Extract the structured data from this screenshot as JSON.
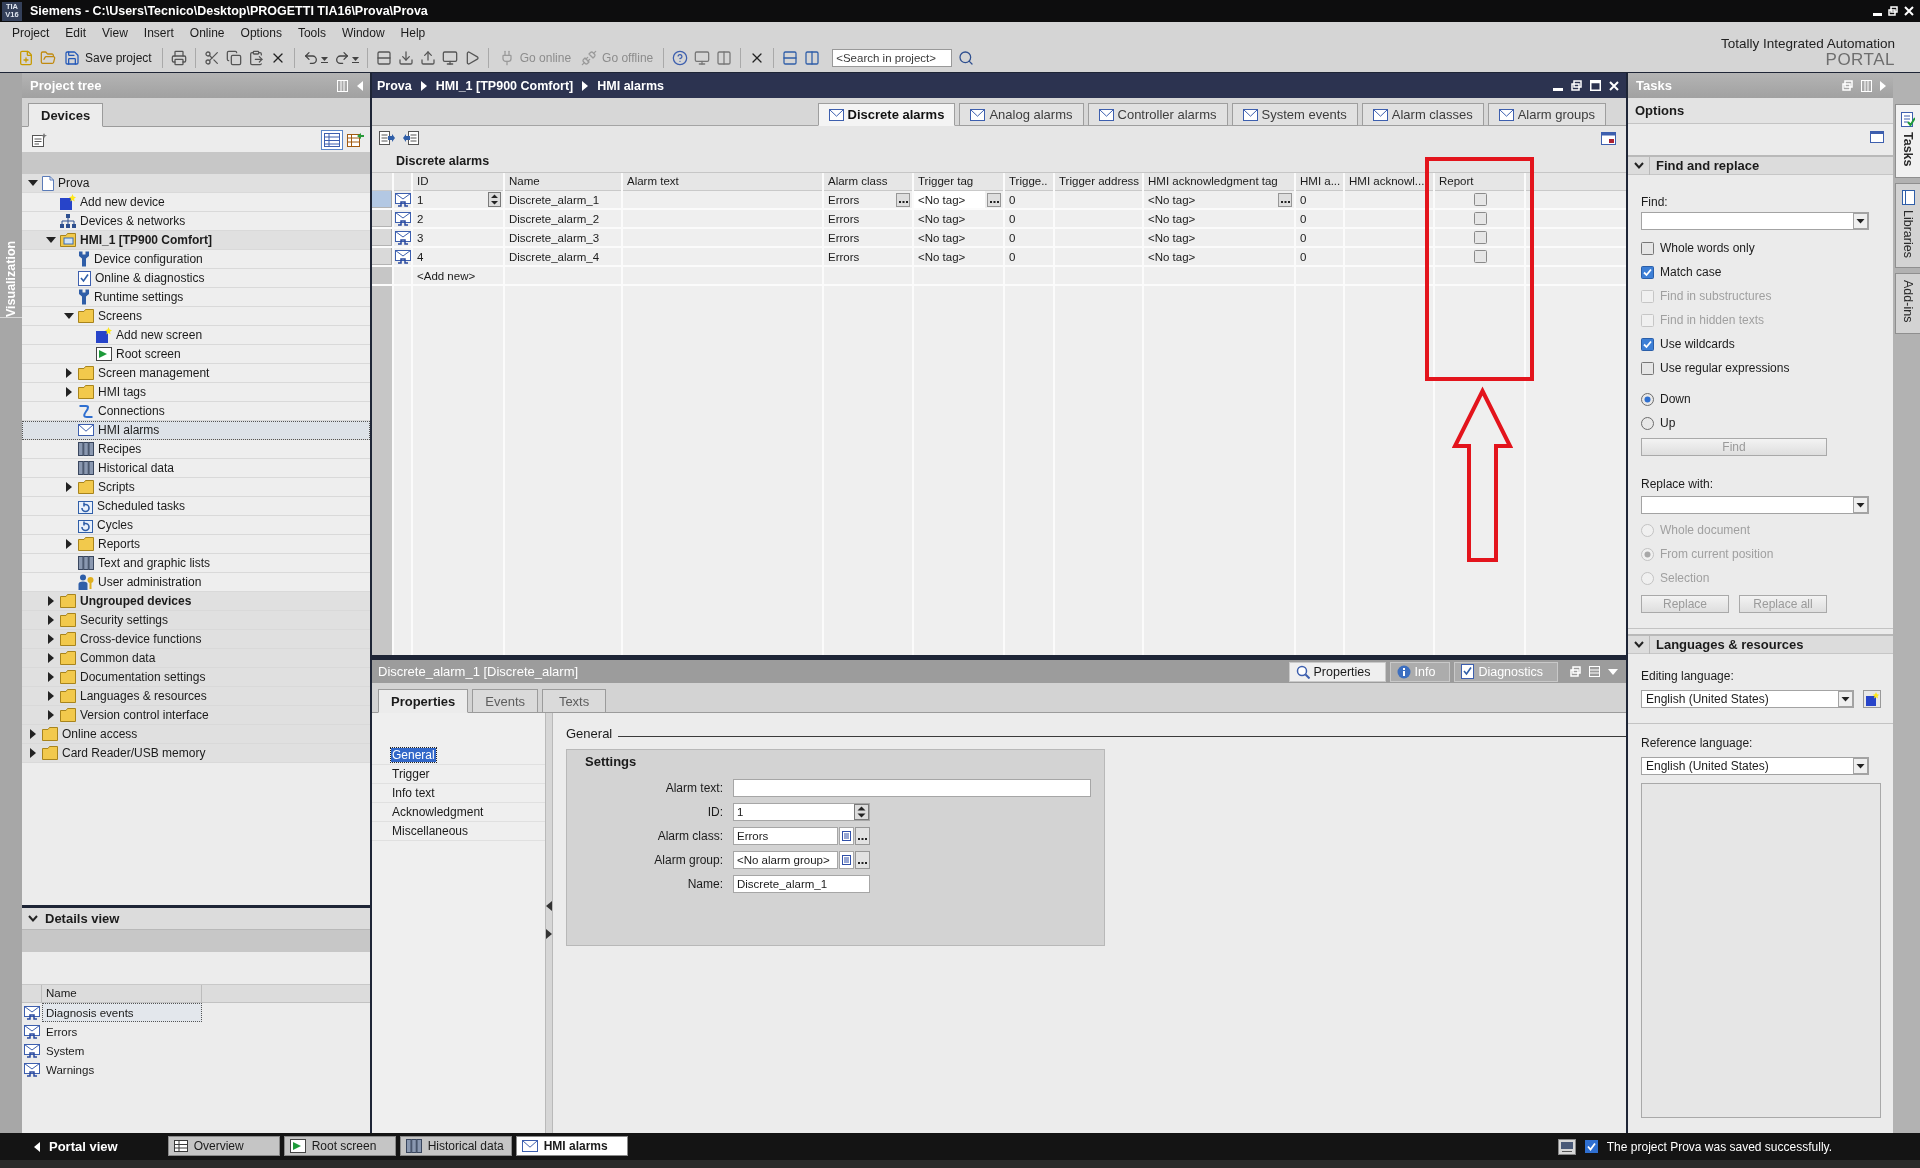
{
  "window": {
    "logo": [
      "TIA",
      "V16"
    ],
    "title": "Siemens - C:\\Users\\Tecnico\\Desktop\\PROGETTI TIA16\\Prova\\Prova"
  },
  "menu": [
    "Project",
    "Edit",
    "View",
    "Insert",
    "Online",
    "Options",
    "Tools",
    "Window",
    "Help"
  ],
  "toolbar": {
    "buttons": [
      {
        "label": "Save project",
        "disabled": false
      },
      {
        "label": "Go online",
        "disabled": true
      },
      {
        "label": "Go offline",
        "disabled": true
      }
    ],
    "search": {
      "placeholder": "<Search in project>"
    }
  },
  "branding": {
    "line_1": "Totally Integrated Automation",
    "line_2": "PORTAL"
  },
  "side_strip": {
    "label": "Visualization"
  },
  "project_tree": {
    "title": "Project tree",
    "tabs": [
      {
        "label": "Devices",
        "selected": true
      }
    ],
    "items": [
      {
        "label": "Prova",
        "kind": "project",
        "expanded": true,
        "selected": false,
        "children": [
          {
            "label": "Add new device",
            "kind": "add",
            "selected": false
          },
          {
            "label": "Devices & networks",
            "kind": "network",
            "selected": false
          },
          {
            "label": "HMI_1 [TP900 Comfort]",
            "kind": "device",
            "expanded": true,
            "selected": false,
            "children": [
              {
                "label": "Device configuration",
                "kind": "settings",
                "selected": false
              },
              {
                "label": "Online & diagnostics",
                "kind": "diagnostics",
                "selected": false
              },
              {
                "label": "Runtime settings",
                "kind": "settings",
                "selected": false
              },
              {
                "label": "Screens",
                "kind": "folder",
                "expanded": true,
                "selected": false,
                "children": [
                  {
                    "label": "Add new screen",
                    "kind": "add",
                    "selected": false
                  },
                  {
                    "label": "Root screen",
                    "kind": "screen",
                    "selected": false
                  }
                ]
              },
              {
                "label": "Screen management",
                "kind": "folder",
                "expanded": false,
                "selected": false
              },
              {
                "label": "HMI tags",
                "kind": "folder",
                "expanded": false,
                "selected": false
              },
              {
                "label": "Connections",
                "kind": "connections",
                "selected": false
              },
              {
                "label": "HMI alarms",
                "kind": "alarms",
                "selected": true
              },
              {
                "label": "Recipes",
                "kind": "records",
                "selected": false
              },
              {
                "label": "Historical data",
                "kind": "records",
                "selected": false
              },
              {
                "label": "Scripts",
                "kind": "folder",
                "expanded": false,
                "selected": false
              },
              {
                "label": "Scheduled tasks",
                "kind": "tasks",
                "selected": false
              },
              {
                "label": "Cycles",
                "kind": "tasks",
                "selected": false
              },
              {
                "label": "Reports",
                "kind": "folder",
                "expanded": false,
                "selected": false
              },
              {
                "label": "Text and graphic lists",
                "kind": "records",
                "selected": false
              },
              {
                "label": "User administration",
                "kind": "users",
                "selected": false
              }
            ]
          },
          {
            "label": "Ungrouped devices",
            "kind": "group",
            "expanded": false,
            "selected": false
          },
          {
            "label": "Security settings",
            "kind": "folder",
            "expanded": false,
            "selected": false
          },
          {
            "label": "Cross-device functions",
            "kind": "folder",
            "expanded": false,
            "selected": false
          },
          {
            "label": "Common data",
            "kind": "folder",
            "expanded": false,
            "selected": false
          },
          {
            "label": "Documentation settings",
            "kind": "folder",
            "expanded": false,
            "selected": false
          },
          {
            "label": "Languages & resources",
            "kind": "folder",
            "expanded": false,
            "selected": false
          },
          {
            "label": "Version control interface",
            "kind": "folder",
            "expanded": false,
            "selected": false
          }
        ]
      },
      {
        "label": "Online access",
        "kind": "folder",
        "expanded": false,
        "selected": false
      },
      {
        "label": "Card Reader/USB memory",
        "kind": "folder",
        "expanded": false,
        "selected": false
      }
    ]
  },
  "details_view": {
    "title": "Details view",
    "expanded": true,
    "column": "Name",
    "rows": [
      {
        "label": "Diagnosis events",
        "selected": true
      },
      {
        "label": "Errors",
        "selected": false
      },
      {
        "label": "System",
        "selected": false
      },
      {
        "label": "Warnings",
        "selected": false
      }
    ]
  },
  "editor": {
    "breadcrumb": [
      "Prova",
      "HMI_1 [TP900 Comfort]",
      "HMI alarms"
    ],
    "tabs": [
      {
        "label": "Discrete alarms",
        "selected": true
      },
      {
        "label": "Analog alarms",
        "selected": false
      },
      {
        "label": "Controller alarms",
        "selected": false
      },
      {
        "label": "System events",
        "selected": false
      },
      {
        "label": "Alarm classes",
        "selected": false
      },
      {
        "label": "Alarm groups",
        "selected": false
      }
    ],
    "table": {
      "title": "Discrete alarms",
      "columns": [
        "ID",
        "Name",
        "Alarm text",
        "Alarm class",
        "Trigger tag",
        "Trigge..",
        "Trigger address",
        "HMI acknowledgment tag",
        "HMI a...",
        "HMI acknowl...",
        "Report"
      ],
      "rows": [
        {
          "id": "1",
          "name": "Discrete_alarm_1",
          "alarm_class": "Errors",
          "trigger_tag": "<No tag>",
          "column_6": "0",
          "hmi_acknowledgment_tag": "<No tag>",
          "column_9": "0",
          "report": false,
          "selected": true
        },
        {
          "id": "2",
          "name": "Discrete_alarm_2",
          "alarm_class": "Errors",
          "trigger_tag": "<No tag>",
          "column_6": "0",
          "hmi_acknowledgment_tag": "<No tag>",
          "column_9": "0",
          "report": false,
          "selected": false
        },
        {
          "id": "3",
          "name": "Discrete_alarm_3",
          "alarm_class": "Errors",
          "trigger_tag": "<No tag>",
          "column_6": "0",
          "hmi_acknowledgment_tag": "<No tag>",
          "column_9": "0",
          "report": false,
          "selected": false
        },
        {
          "id": "4",
          "name": "Discrete_alarm_4",
          "alarm_class": "Errors",
          "trigger_tag": "<No tag>",
          "column_6": "0",
          "hmi_acknowledgment_tag": "<No tag>",
          "column_9": "0",
          "report": false,
          "selected": false
        }
      ],
      "add_new": "<Add new>"
    }
  },
  "inspector": {
    "title": "Discrete_alarm_1 [Discrete_alarm]",
    "views": [
      {
        "label": "Properties",
        "kind": "properties",
        "selected": true
      },
      {
        "label": "Info",
        "kind": "info",
        "selected": false
      },
      {
        "label": "Diagnostics",
        "kind": "diagnostics",
        "selected": false
      }
    ],
    "tabs": [
      {
        "label": "Properties",
        "selected": true
      },
      {
        "label": "Events",
        "selected": false
      },
      {
        "label": "Texts",
        "selected": false
      }
    ],
    "nav": [
      {
        "label": "General",
        "selected": true
      },
      {
        "label": "Trigger",
        "selected": false
      },
      {
        "label": "Info text",
        "selected": false
      },
      {
        "label": "Acknowledgment",
        "selected": false
      },
      {
        "label": "Miscellaneous",
        "selected": false
      }
    ],
    "section_title": "General",
    "group": {
      "title": "Settings",
      "fields": [
        {
          "label": "Alarm text:",
          "kind": "wide"
        },
        {
          "label": "ID:",
          "kind": "spin",
          "value": "1"
        },
        {
          "label": "Alarm class:",
          "kind": "pick",
          "value": "Errors"
        },
        {
          "label": "Alarm group:",
          "kind": "pick",
          "value": "<No alarm group>"
        },
        {
          "label": "Name:",
          "kind": "text",
          "value": "Discrete_alarm_1"
        }
      ]
    }
  },
  "tasks_pane": {
    "title": "Tasks",
    "heading": "Options"
  },
  "find_replace": {
    "title": "Find and replace",
    "expanded": true,
    "find_label": "Find:",
    "options": [
      {
        "label": "Whole words only",
        "checked": false,
        "disabled": false
      },
      {
        "label": "Match case",
        "checked": true,
        "disabled": false
      },
      {
        "label": "Find in substructures",
        "checked": false,
        "disabled": true
      },
      {
        "label": "Find in hidden texts",
        "checked": false,
        "disabled": true
      },
      {
        "label": "Use wildcards",
        "checked": true,
        "disabled": false
      },
      {
        "label": "Use regular expressions",
        "checked": false,
        "disabled": false
      }
    ],
    "direction": [
      {
        "label": "Down",
        "selected": true,
        "disabled": false
      },
      {
        "label": "Up",
        "selected": false,
        "disabled": false
      }
    ],
    "find_button": {
      "label": "Find",
      "disabled": true
    },
    "replace_label": "Replace with:",
    "scope": [
      {
        "label": "Whole document",
        "selected": false,
        "disabled": true
      },
      {
        "label": "From current position",
        "selected": true,
        "disabled": true
      },
      {
        "label": "Selection",
        "selected": false,
        "disabled": true
      }
    ],
    "replace_buttons": [
      {
        "label": "Replace",
        "disabled": true
      },
      {
        "label": "Replace all",
        "disabled": true
      }
    ]
  },
  "languages": {
    "title": "Languages & resources",
    "expanded": true,
    "editing_label": "Editing language:",
    "editing_value": "English (United States)",
    "reference_label": "Reference language:",
    "reference_value": "English (United States)"
  },
  "side_tabs": [
    {
      "label": "Tasks",
      "selected": true
    },
    {
      "label": "Libraries",
      "selected": false
    },
    {
      "label": "Add-ins",
      "selected": false
    }
  ],
  "status_bar": {
    "portal_view": "Portal view",
    "editors": [
      {
        "label": "Overview",
        "kind": "overview",
        "selected": false
      },
      {
        "label": "Root screen",
        "kind": "screen",
        "selected": false
      },
      {
        "label": "Historical data",
        "kind": "records",
        "selected": false
      },
      {
        "label": "HMI alarms",
        "kind": "alarms",
        "selected": true
      }
    ],
    "message": "The project Prova was saved successfully."
  }
}
